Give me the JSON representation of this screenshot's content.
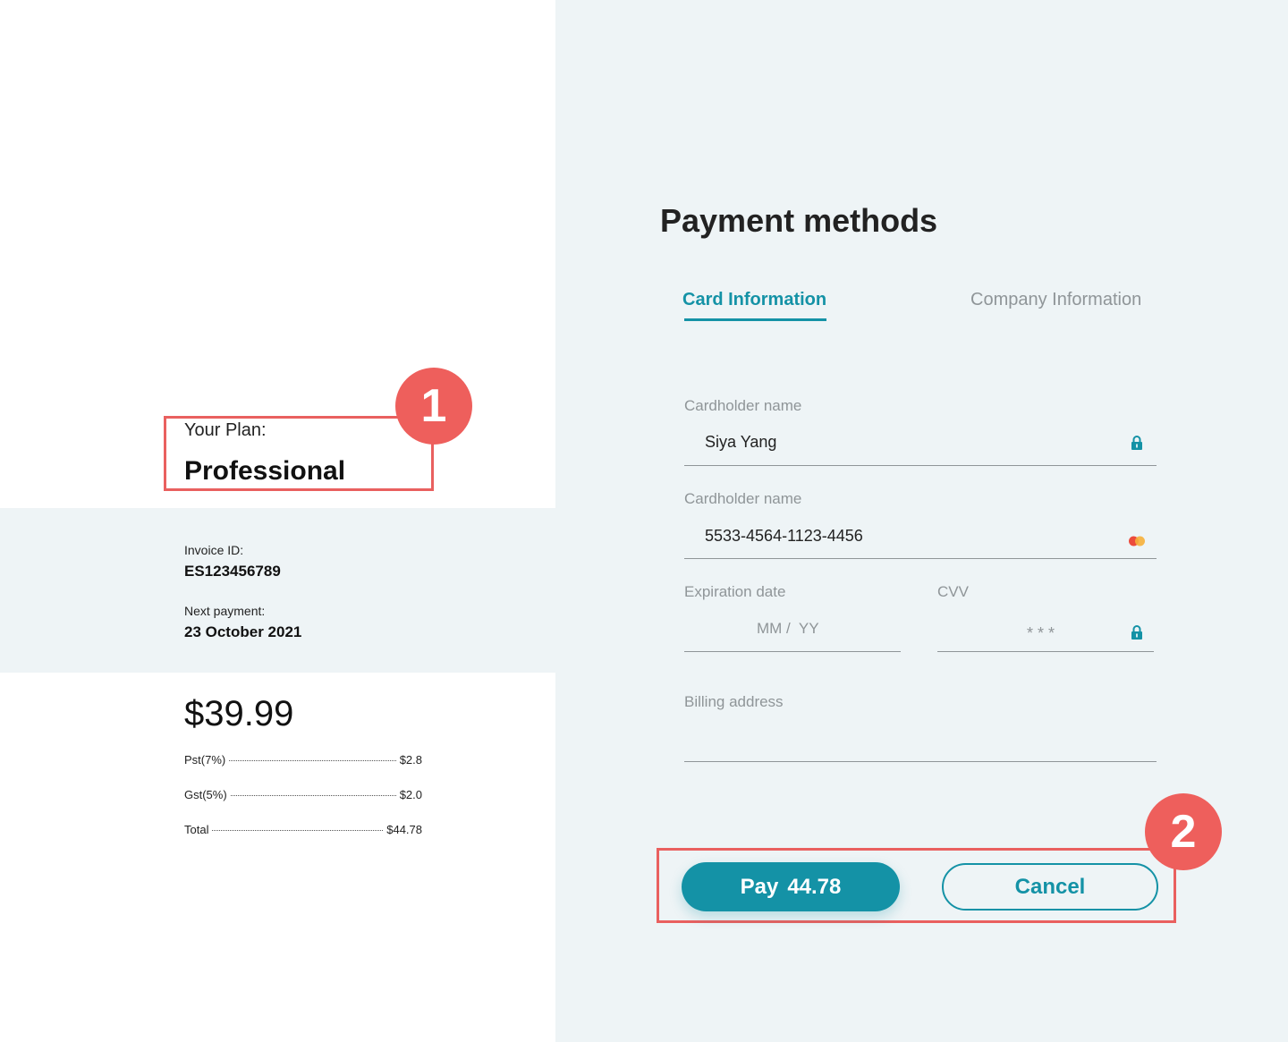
{
  "plan": {
    "label": "Your Plan:",
    "name": "Professional"
  },
  "annotations": {
    "badge_1": "1",
    "badge_2": "2",
    "color": "#ee5f5c"
  },
  "invoice": {
    "id_label": "Invoice ID:",
    "id_value": "ES123456789",
    "next_label": "Next payment:",
    "next_value": "23 October 2021"
  },
  "pricing": {
    "price": "$39.99",
    "lines": [
      {
        "label": "Pst(7%)",
        "value": "$2.8"
      },
      {
        "label": "Gst(5%)",
        "value": "$2.0"
      },
      {
        "label": "Total",
        "value": "$44.78"
      }
    ]
  },
  "payment": {
    "title": "Payment methods",
    "tabs": [
      {
        "label": "Card Information",
        "active": true
      },
      {
        "label": "Company Information",
        "active": false
      }
    ],
    "fields": {
      "cardholder": {
        "label": "Cardholder name",
        "value": "Siya Yang",
        "icon": "lock-icon"
      },
      "card_number": {
        "label": "Cardholder name",
        "value": "5533-4564-1123-4456",
        "icon": "mastercard-icon"
      },
      "expiration": {
        "label": "Expiration date",
        "placeholder": "MM /  YY"
      },
      "cvv": {
        "label": "CVV",
        "placeholder": "* * *",
        "icon": "lock-icon"
      },
      "billing": {
        "label": "Billing address",
        "value": ""
      }
    },
    "buttons": {
      "pay_label": "Pay",
      "pay_amount": "44.78",
      "cancel_label": "Cancel"
    }
  },
  "colors": {
    "accent": "#1492a6",
    "panel_bg": "#eef4f6",
    "highlight": "#e9605f"
  }
}
